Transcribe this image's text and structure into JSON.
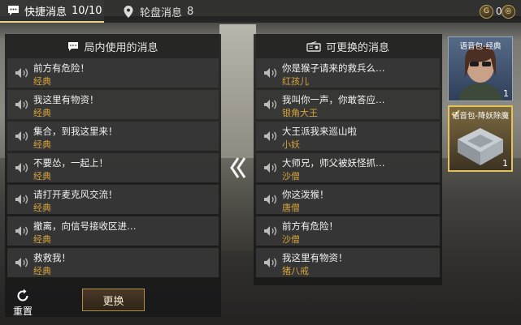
{
  "tabs": {
    "quick": {
      "label": "快捷消息",
      "count": "10/10"
    },
    "wheel": {
      "label": "轮盘消息",
      "count": "8"
    }
  },
  "currency": [
    {
      "icon": "coin-icon",
      "symbol": "G",
      "value": "0"
    },
    {
      "icon": "token-icon",
      "symbol": "◎",
      "value": ""
    }
  ],
  "left_panel": {
    "title": "局内使用的消息",
    "items": [
      {
        "text": "前方有危险！",
        "category": "经典"
      },
      {
        "text": "我这里有物资！",
        "category": "经典"
      },
      {
        "text": "集合，到我这里来！",
        "category": "经典"
      },
      {
        "text": "不要怂，一起上！",
        "category": "经典"
      },
      {
        "text": "请打开麦克风交流！",
        "category": "经典"
      },
      {
        "text": "撤离，向信号接收区进…",
        "category": "经典"
      },
      {
        "text": "救救我！",
        "category": "经典"
      }
    ],
    "swap_button": "更换",
    "reset_label": "重置"
  },
  "right_panel": {
    "title": "可更换的消息",
    "items": [
      {
        "text": "你是猴子请来的救兵么…",
        "category": "红孩儿"
      },
      {
        "text": "我叫你一声，你敢答应…",
        "category": "银角大王"
      },
      {
        "text": "大王派我来巡山啦",
        "category": "小妖"
      },
      {
        "text": "大师兄，师父被妖怪抓…",
        "category": "沙僧"
      },
      {
        "text": "你这泼猴！",
        "category": "唐僧"
      },
      {
        "text": "前方有危险！",
        "category": "沙僧"
      },
      {
        "text": "我这里有物资！",
        "category": "猪八戒"
      }
    ]
  },
  "item_cards": [
    {
      "label": "语音包-经典",
      "count": "1"
    },
    {
      "label": "语音包-降妖除魔",
      "count": "1"
    }
  ],
  "colors": {
    "accent": "#d6a33c",
    "tab_underline": "#e8d08a",
    "selected_border": "#e3c25a"
  }
}
